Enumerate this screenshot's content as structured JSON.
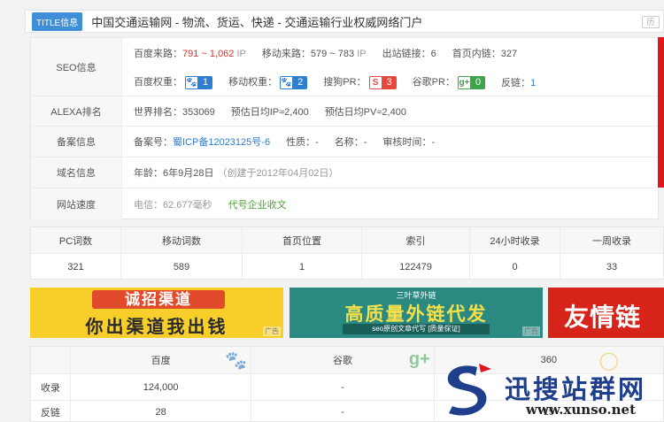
{
  "title": {
    "tag": "TITLE信息",
    "text": "中国交通运输网 - 物流、货运、快递 - 交通运输行业权威网络门户",
    "right": "历"
  },
  "seo": {
    "label": "SEO信息",
    "row1": {
      "baidu_label": "百度来路：",
      "baidu_value": "791 ~ 1,062",
      "mobile_label": "移动来路：",
      "mobile_value": "579 ~ 783",
      "unit": "IP",
      "outlinks_label": "出站链接：",
      "outlinks_value": "6",
      "homelinks_label": "首页内链：",
      "homelinks_value": "327"
    },
    "row2": {
      "baidu_weight_label": "百度权重：",
      "baidu_weight_value": "1",
      "mobile_weight_label": "移动权重：",
      "mobile_weight_value": "2",
      "sogou_label": "搜狗PR：",
      "sogou_value": "3",
      "google_label": "谷歌PR：",
      "google_value": "0",
      "backlink_label": "反链：",
      "backlink_value": "1"
    }
  },
  "alexa": {
    "label": "ALEXA排名",
    "rank_label": "世界排名：",
    "rank_value": "353069",
    "ip_label": "预估日均IP≈",
    "ip_value": "2,400",
    "pv_label": "预估日均PV≈",
    "pv_value": "2,400"
  },
  "beian": {
    "label": "备案信息",
    "no_label": "备案号：",
    "no_value": "蜀ICP备12023125号-6",
    "nature_label": "性质：",
    "nature_value": "-",
    "name_label": "名称：",
    "name_value": "-",
    "time_label": "审核时间：",
    "time_value": "-"
  },
  "domain": {
    "label": "域名信息",
    "age_label": "年龄：",
    "age_value": "6年9月28日",
    "created": "（创建于2012年04月02日）"
  },
  "speed": {
    "label": "网站速度",
    "telecom_label": "电信：",
    "telecom_value": "62.677毫秒",
    "proxy": "代号企业收文"
  },
  "stats": {
    "headers": [
      "PC词数",
      "移动词数",
      "首页位置",
      "索引",
      "24小时收录",
      "一周收录"
    ],
    "values": [
      "321",
      "589",
      "1",
      "122479",
      "0",
      "33"
    ]
  },
  "ads": {
    "ad1": {
      "tag": "诚招渠道",
      "text": "你出渠道我出钱",
      "corner": "广告"
    },
    "ad2": {
      "top": "三叶草外链",
      "text": "高质量外链代发",
      "bar": "seo原创文章代写 [质量保证]",
      "corner": "广告"
    },
    "ad3": {
      "text": "友情链"
    }
  },
  "engines": {
    "headers": [
      "",
      "百度",
      "谷歌",
      "360"
    ],
    "rows": [
      {
        "label": "收录",
        "values": [
          "124,000",
          "-",
          ""
        ]
      },
      {
        "label": "反链",
        "values": [
          "28",
          "-",
          "15"
        ]
      }
    ]
  },
  "watermark": {
    "text": "迅搜站群网",
    "url": "www.xunso.net"
  },
  "colors": {
    "accent_blue": "#3f8fd8",
    "alert_red": "#d9322c",
    "watermark_blue": "#1f3e8c"
  }
}
